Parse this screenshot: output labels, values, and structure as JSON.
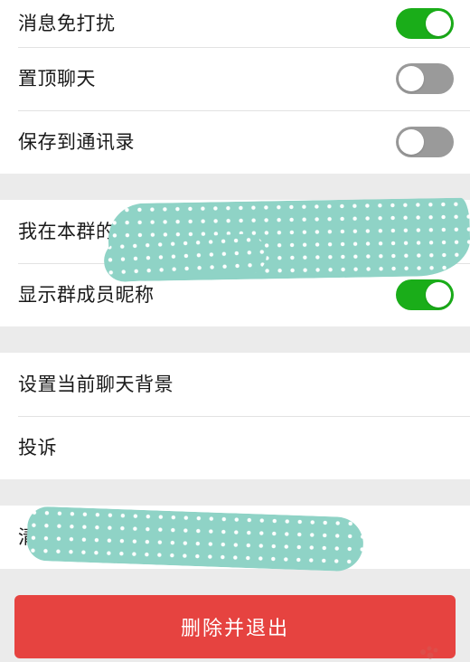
{
  "settings": {
    "group1": [
      {
        "label": "消息免打扰",
        "toggle": "on"
      },
      {
        "label": "置顶聊天",
        "toggle": "off"
      },
      {
        "label": "保存到通讯录",
        "toggle": "off"
      }
    ],
    "group2": [
      {
        "label": "我在本群的昵"
      },
      {
        "label": "显示群成员昵称",
        "toggle": "on"
      }
    ],
    "group3": [
      {
        "label": "设置当前聊天背景"
      },
      {
        "label": "投诉"
      }
    ],
    "group4": [
      {
        "label": "清"
      }
    ]
  },
  "actions": {
    "delete_exit_label": "删除并退出"
  },
  "colors": {
    "toggle_on": "#1aad19",
    "toggle_off": "#9a9a9a",
    "danger": "#e64340",
    "background": "#ebebeb"
  }
}
